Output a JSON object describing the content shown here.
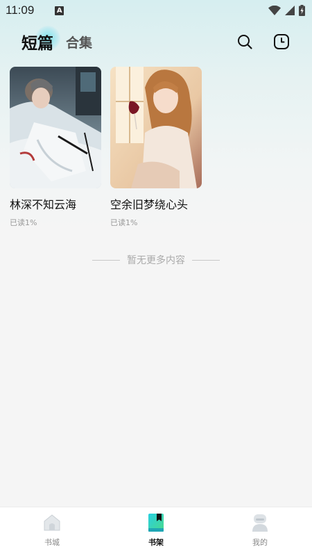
{
  "status_bar": {
    "time": "11:09",
    "notification_letter": "A"
  },
  "header": {
    "tabs": [
      {
        "label": "短篇",
        "active": true
      },
      {
        "label": "合集",
        "active": false
      }
    ],
    "icons": [
      "search-icon",
      "history-icon"
    ]
  },
  "books": [
    {
      "title": "林深不知云海",
      "progress": "已读1%",
      "cover_desc": "hospital-bed-man"
    },
    {
      "title": "空余旧梦绕心头",
      "progress": "已读1%",
      "cover_desc": "woman-with-wine"
    }
  ],
  "list_footer": {
    "text": "暂无更多内容"
  },
  "bottom_nav": {
    "items": [
      {
        "label": "书城",
        "icon": "home-icon",
        "active": false
      },
      {
        "label": "书架",
        "icon": "bookshelf-icon",
        "active": true
      },
      {
        "label": "我的",
        "icon": "profile-icon",
        "active": false
      }
    ]
  },
  "colors": {
    "accent": "#36c9d6",
    "background": "#f5f5f5"
  }
}
